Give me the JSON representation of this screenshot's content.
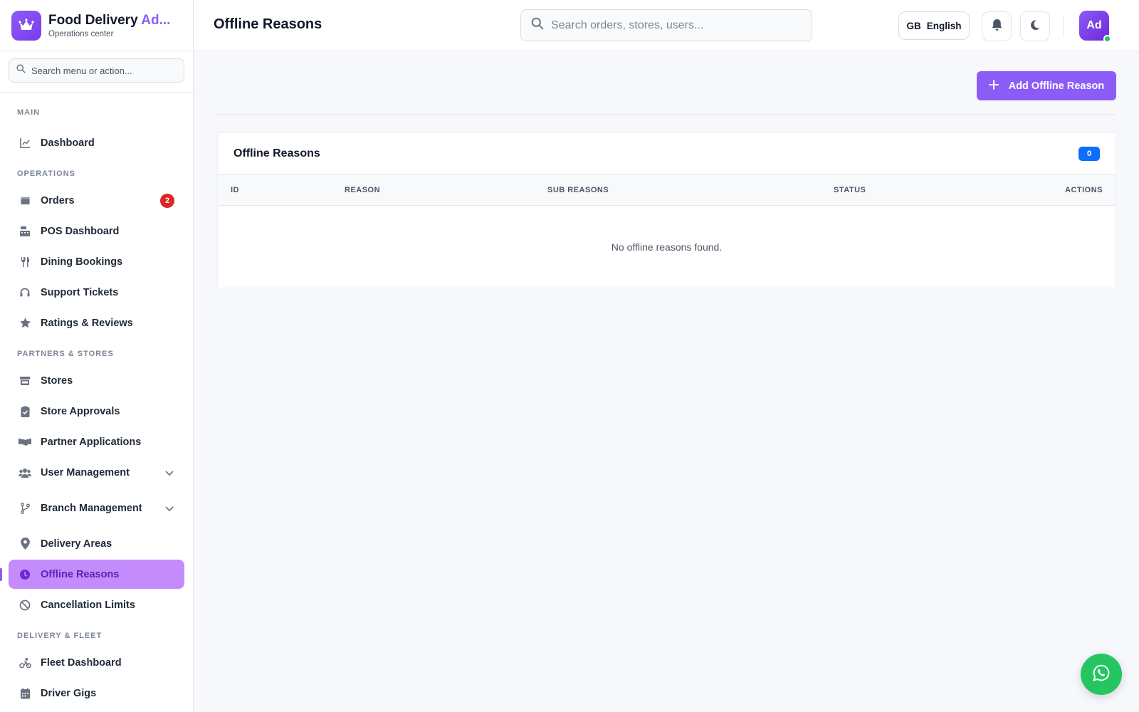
{
  "brand": {
    "title_main": "Food Delivery ",
    "title_accent": "Ad...",
    "subtitle": "Operations center",
    "logo_icon": "crown-icon"
  },
  "sidebar": {
    "search_placeholder": "Search menu or action...",
    "sections": [
      {
        "label": "MAIN",
        "items": [
          {
            "label": "Dashboard",
            "icon": "chart-line-icon"
          }
        ]
      },
      {
        "label": "OPERATIONS",
        "items": [
          {
            "label": "Orders",
            "icon": "box-icon",
            "badge": "2"
          },
          {
            "label": "POS Dashboard",
            "icon": "cash-register-icon"
          },
          {
            "label": "Dining Bookings",
            "icon": "utensils-icon"
          },
          {
            "label": "Support Tickets",
            "icon": "headset-icon"
          },
          {
            "label": "Ratings & Reviews",
            "icon": "star-icon"
          }
        ]
      },
      {
        "label": "PARTNERS & STORES",
        "items": [
          {
            "label": "Stores",
            "icon": "store-icon"
          },
          {
            "label": "Store Approvals",
            "icon": "clipboard-check-icon"
          },
          {
            "label": "Partner Applications",
            "icon": "handshake-icon"
          },
          {
            "label": "User Management",
            "icon": "users-icon",
            "expandable": true
          },
          {
            "label": "Branch Management",
            "icon": "branch-icon",
            "expandable": true
          },
          {
            "label": "Delivery Areas",
            "icon": "map-pin-icon"
          },
          {
            "label": "Offline Reasons",
            "icon": "clock-icon",
            "active": true
          },
          {
            "label": "Cancellation Limits",
            "icon": "ban-icon"
          }
        ]
      },
      {
        "label": "DELIVERY & FLEET",
        "items": [
          {
            "label": "Fleet Dashboard",
            "icon": "rider-icon"
          },
          {
            "label": "Driver Gigs",
            "icon": "calendar-icon"
          }
        ]
      }
    ]
  },
  "topbar": {
    "page_title": "Offline Reasons",
    "search_placeholder": "Search orders, stores, users...",
    "language": {
      "flag": "GB",
      "label": "English"
    },
    "avatar_initials": "Ad"
  },
  "main": {
    "add_button_label": "Add Offline Reason",
    "card": {
      "title": "Offline Reasons",
      "count": "0",
      "columns": [
        "ID",
        "REASON",
        "SUB REASONS",
        "STATUS",
        "ACTIONS"
      ],
      "empty_message": "No offline reasons found."
    }
  },
  "colors": {
    "accent": "#8b5cf6",
    "active_bg": "#c48bfb",
    "badge_red": "#dc2626",
    "count_blue": "#0d6efd",
    "whatsapp": "#25c661"
  }
}
